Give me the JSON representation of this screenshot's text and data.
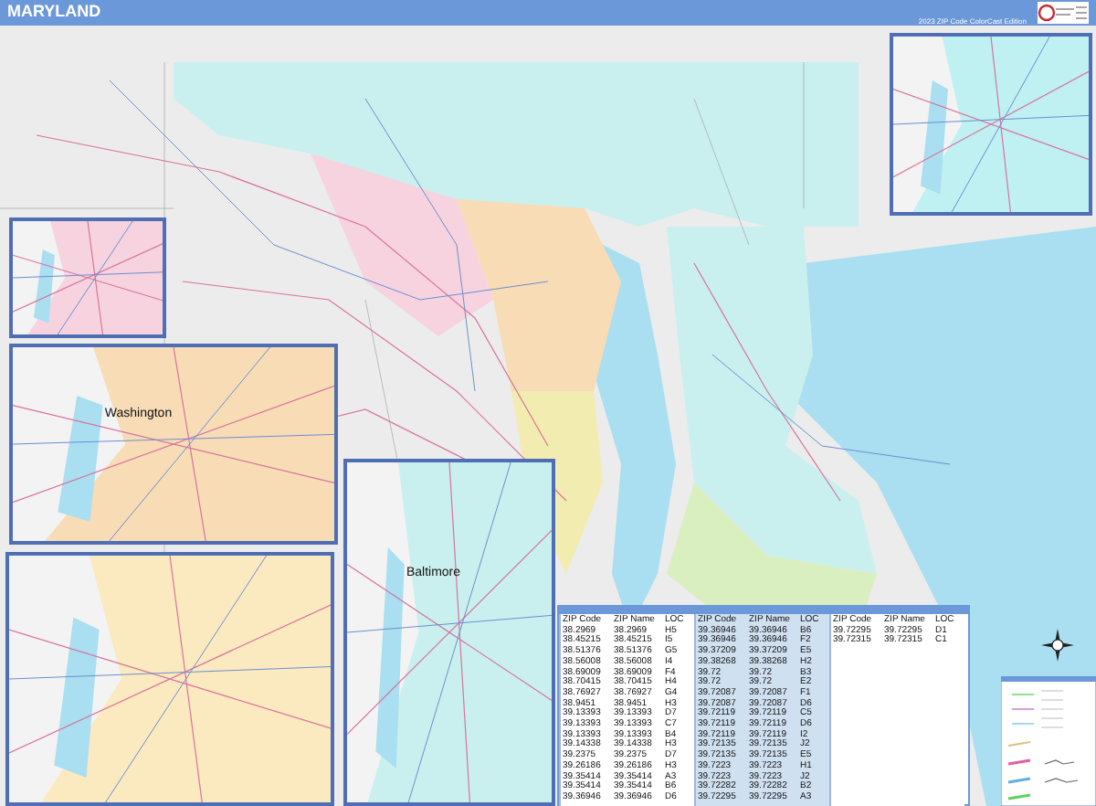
{
  "header": {
    "title": "MARYLAND",
    "edition": "2023 ZIP Code ColorCast Edition"
  },
  "insets": [
    {
      "kind": "plain"
    },
    {
      "kind": "plain"
    },
    {
      "kind": "city",
      "label": "Washington"
    },
    {
      "kind": "plain"
    },
    {
      "kind": "city",
      "label": "Baltimore"
    }
  ],
  "zip_index": {
    "groups": [
      {
        "shaded": false,
        "columns": [
          "ZIP Code",
          "ZIP Name",
          "LOC"
        ],
        "rows": [
          [
            "38.2969",
            "38.2969",
            "H5"
          ],
          [
            "38.45215",
            "38.45215",
            "I5"
          ],
          [
            "38.51376",
            "38.51376",
            "G5"
          ],
          [
            "38.56008",
            "38.56008",
            "I4"
          ],
          [
            "38.69009",
            "38.69009",
            "F4"
          ],
          [
            "38.70415",
            "38.70415",
            "H4"
          ],
          [
            "38.76927",
            "38.76927",
            "G4"
          ],
          [
            "38.9451",
            "38.9451",
            "H3"
          ],
          [
            "39.13393",
            "39.13393",
            "D7"
          ],
          [
            "39.13393",
            "39.13393",
            "C7"
          ],
          [
            "39.13393",
            "39.13393",
            "B4"
          ],
          [
            "39.14338",
            "39.14338",
            "H3"
          ],
          [
            "39.2375",
            "39.2375",
            "D7"
          ],
          [
            "39.26186",
            "39.26186",
            "H3"
          ],
          [
            "39.35414",
            "39.35414",
            "A3"
          ],
          [
            "39.35414",
            "39.35414",
            "B6"
          ],
          [
            "39.36946",
            "39.36946",
            "D6"
          ]
        ]
      },
      {
        "shaded": true,
        "columns": [
          "ZIP Code",
          "ZIP Name",
          "LOC"
        ],
        "rows": [
          [
            "39.36946",
            "39.36946",
            "B6"
          ],
          [
            "39.36946",
            "39.36946",
            "F2"
          ],
          [
            "39.37209",
            "39.37209",
            "E5"
          ],
          [
            "39.38268",
            "39.38268",
            "H2"
          ],
          [
            "39.72",
            "39.72",
            "B3"
          ],
          [
            "39.72",
            "39.72",
            "E2"
          ],
          [
            "39.72087",
            "39.72087",
            "F1"
          ],
          [
            "39.72087",
            "39.72087",
            "D6"
          ],
          [
            "39.72119",
            "39.72119",
            "C5"
          ],
          [
            "39.72119",
            "39.72119",
            "D6"
          ],
          [
            "39.72119",
            "39.72119",
            "I2"
          ],
          [
            "39.72135",
            "39.72135",
            "J2"
          ],
          [
            "39.72135",
            "39.72135",
            "E5"
          ],
          [
            "39.7223",
            "39.7223",
            "H1"
          ],
          [
            "39.7223",
            "39.7223",
            "J2"
          ],
          [
            "39.72282",
            "39.72282",
            "B2"
          ],
          [
            "39.72295",
            "39.72295",
            "A3"
          ]
        ]
      },
      {
        "shaded": false,
        "columns": [
          "ZIP Code",
          "ZIP Name",
          "LOC"
        ],
        "rows": [
          [
            "39.72295",
            "39.72295",
            "D1"
          ],
          [
            "39.72315",
            "39.72315",
            "C1"
          ]
        ]
      }
    ]
  }
}
